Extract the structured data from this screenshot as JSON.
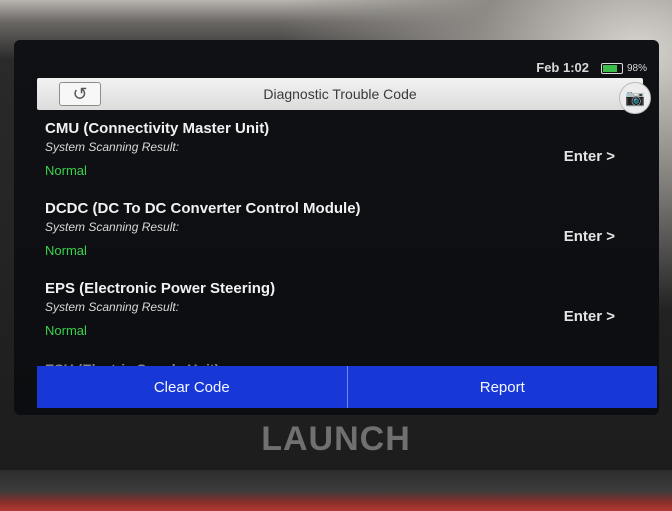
{
  "status": {
    "time": "Feb 1:02",
    "battery": "98%"
  },
  "header": {
    "title": "Diagnostic Trouble Code"
  },
  "items": [
    {
      "title": "CMU (Connectivity Master Unit)",
      "subtitle": "System Scanning Result:",
      "status": "Normal",
      "action": "Enter >"
    },
    {
      "title": "DCDC (DC To DC Converter Control Module)",
      "subtitle": "System Scanning Result:",
      "status": "Normal",
      "action": "Enter >"
    },
    {
      "title": "EPS (Electronic Power Steering)",
      "subtitle": "System Scanning Result:",
      "status": "Normal",
      "action": "Enter >"
    }
  ],
  "partial_item": {
    "title": "ESU (Electric Supply Unit)"
  },
  "buttons": {
    "clear": "Clear Code",
    "report": "Report"
  },
  "brand": "LAUNCH"
}
